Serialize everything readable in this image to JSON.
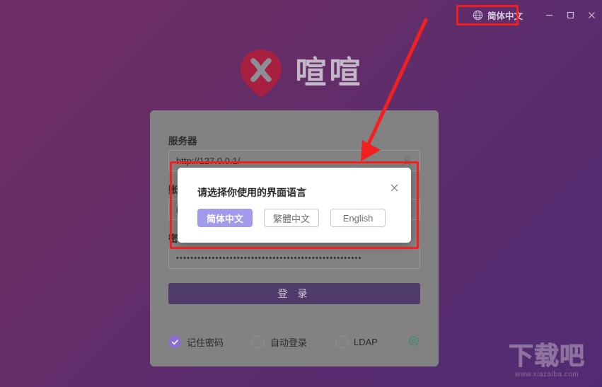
{
  "titlebar": {
    "language_label": "简体中文",
    "globe_icon": "globe-icon",
    "minimize_label": "−",
    "maximize_label": "□",
    "close_label": "✕"
  },
  "brand": {
    "logo_icon": "x-pin-logo-icon",
    "name": "喧喧"
  },
  "login_form": {
    "server_label": "服务器",
    "server_value": "http://127.0.0.1/",
    "server_icon": "user-icon",
    "account_label": "账号",
    "account_value": "ij",
    "password_label": "密码",
    "password_value": "••••••••••••••••••••••••••••••••••••••••••••••••••••",
    "login_button": "登 录",
    "options": [
      {
        "label": "记住密码",
        "checked": true
      },
      {
        "label": "自动登录",
        "checked": false
      },
      {
        "label": "LDAP",
        "checked": false
      }
    ],
    "settings_icon": "gear-icon"
  },
  "language_dialog": {
    "title": "请选择你使用的界面语言",
    "close_label": "✕",
    "buttons": [
      {
        "label": "简体中文",
        "active": true
      },
      {
        "label": "繁體中文",
        "active": false
      },
      {
        "label": "English",
        "active": false
      }
    ]
  },
  "watermark": {
    "main": "下载吧",
    "sub": "www.xiazaiba.com"
  },
  "colors": {
    "bg_start": "#6d2d66",
    "bg_end": "#512b72",
    "panel": "#828282",
    "accent_purple": "#a29bec",
    "login_button": "#4f3c6b",
    "checkbox_on": "#8b6fd1",
    "gear_teal": "#3f8a72",
    "annotation_red": "#f42020",
    "logo_red": "#a8203f"
  }
}
